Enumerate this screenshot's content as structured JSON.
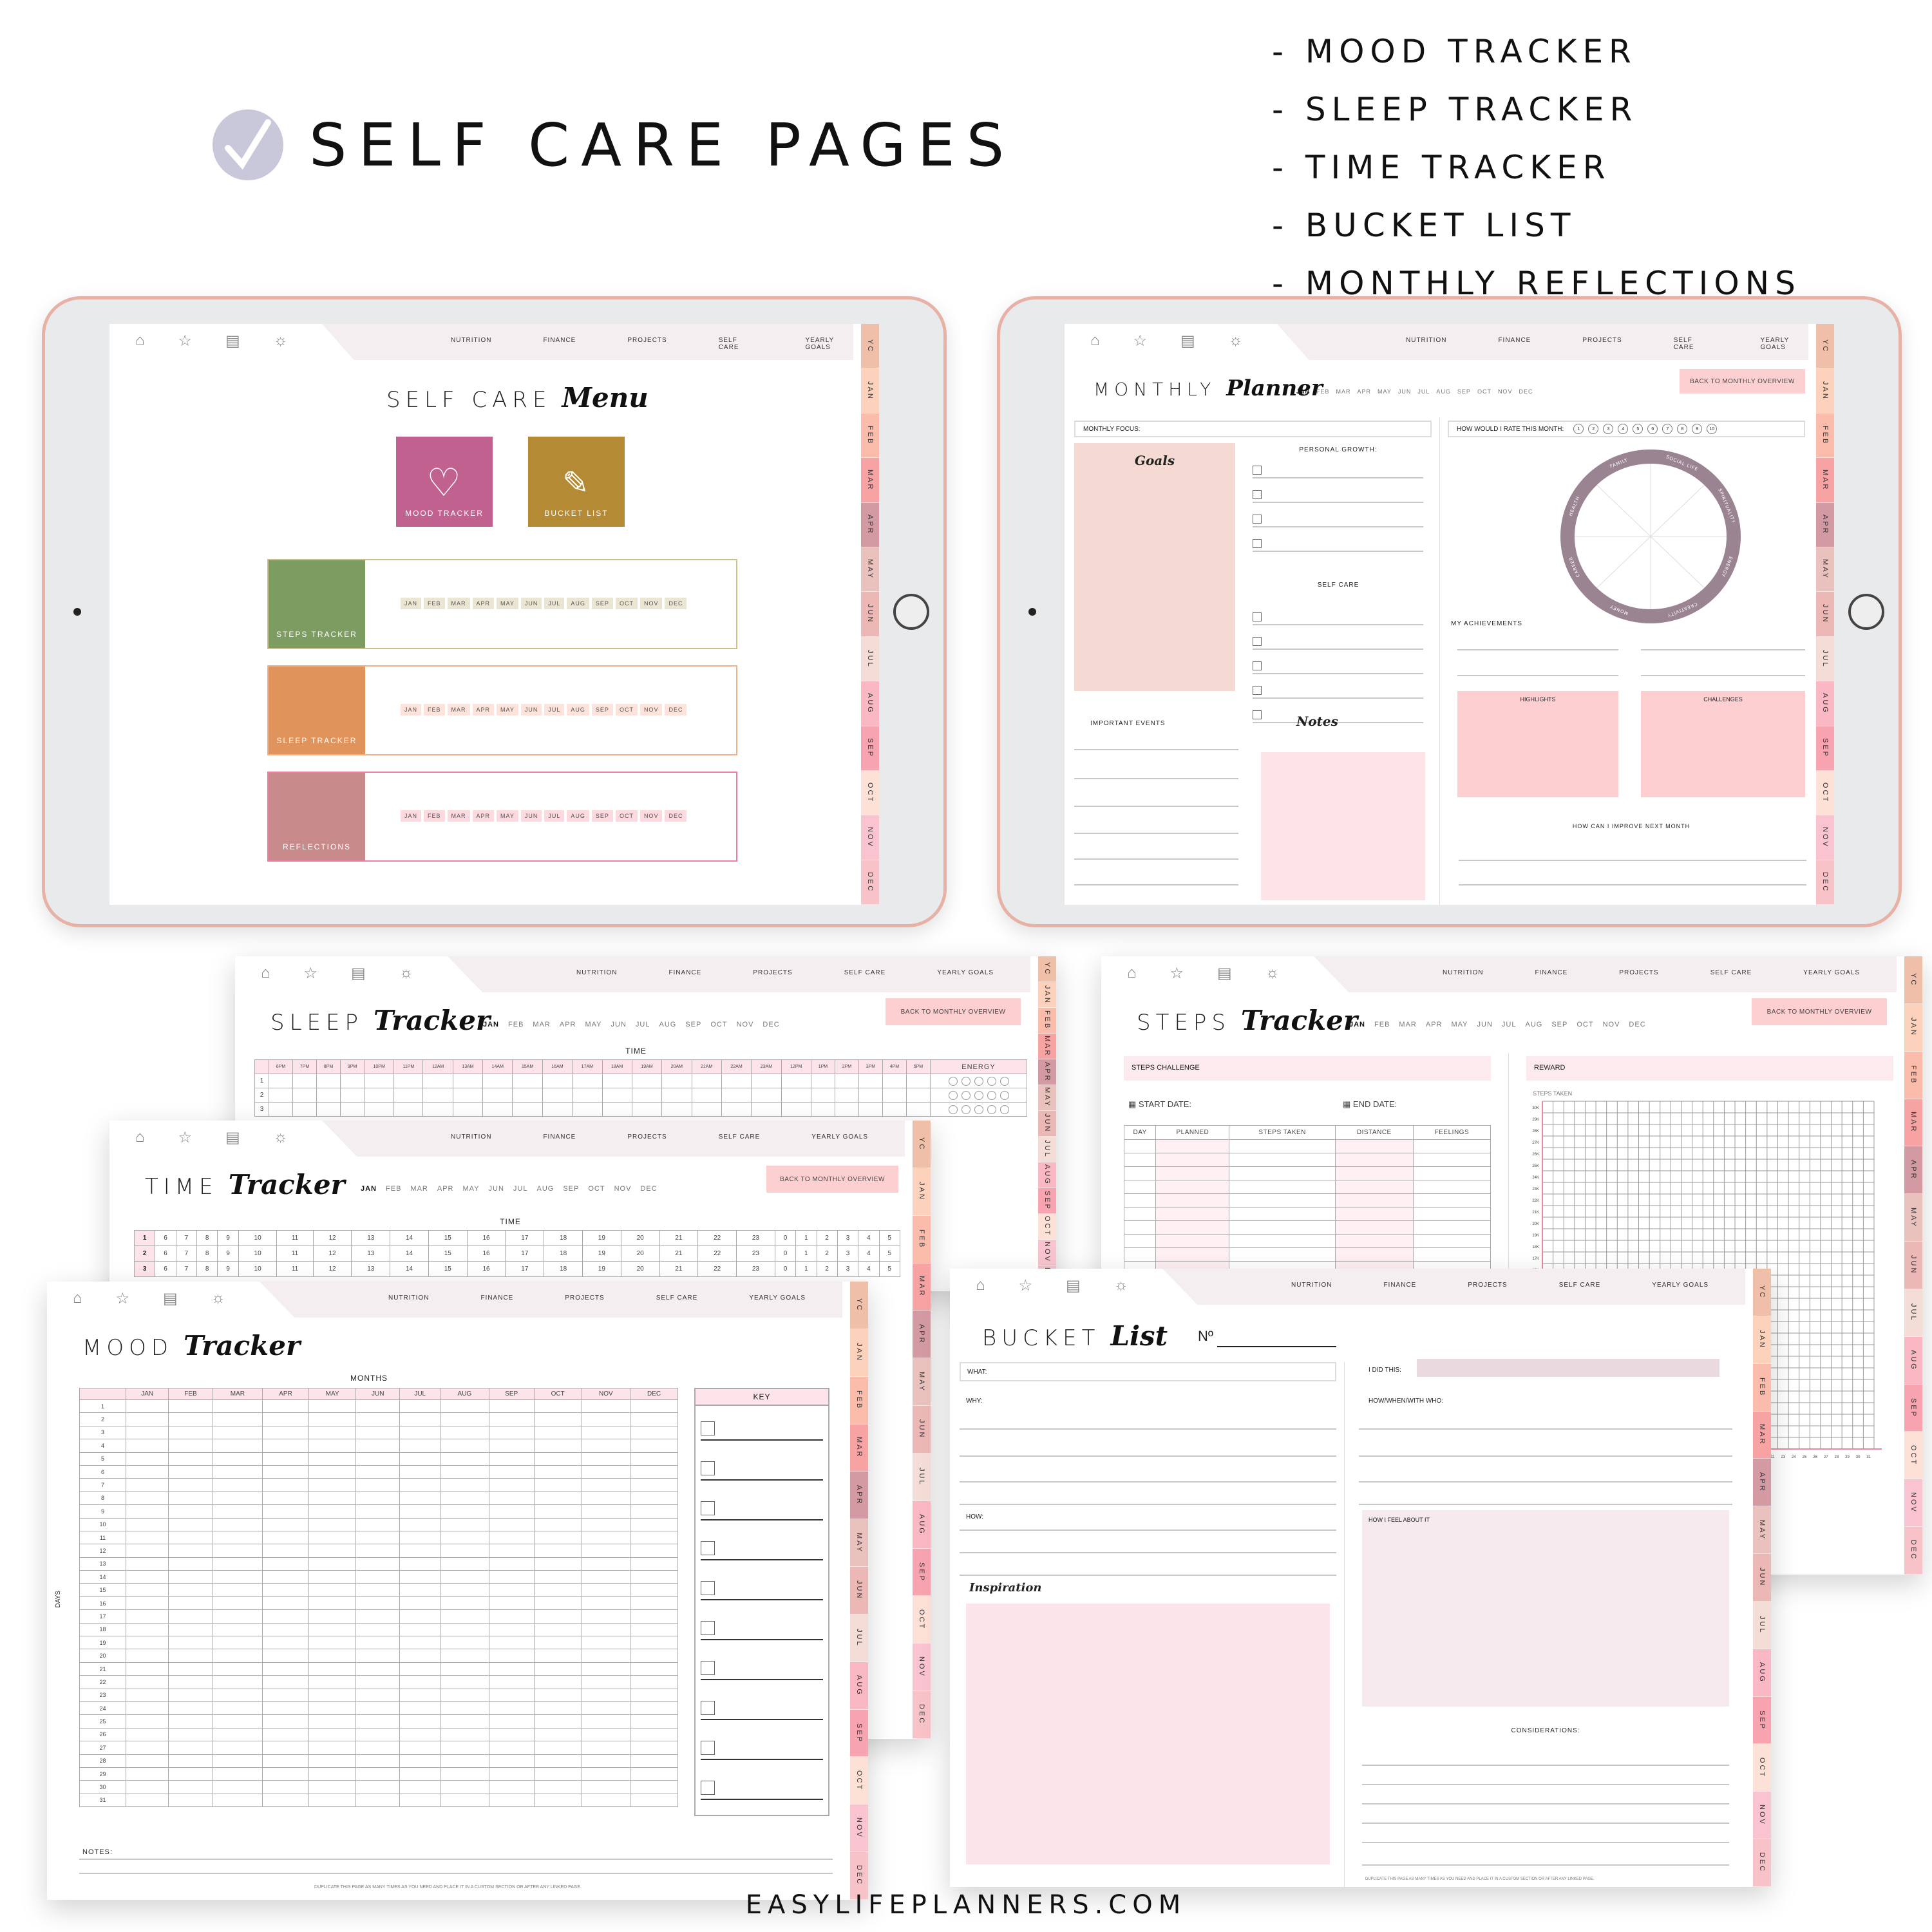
{
  "header": {
    "title": "SELF CARE PAGES",
    "check_icon": "check-circle-icon",
    "features": [
      "- MOOD TRACKER",
      "- SLEEP TRACKER",
      "- TIME TRACKER",
      "- BUCKET LIST",
      "- MONTHLY REFLECTIONS"
    ]
  },
  "footer": {
    "url": "EASYLIFEPLANNERS.COM"
  },
  "nav": {
    "icons": [
      "home-icon",
      "star-icon",
      "notebook-icon",
      "lightbulb-icon"
    ],
    "links": [
      "NUTRITION",
      "FINANCE",
      "PROJECTS",
      "SELF CARE",
      "YEARLY GOALS"
    ]
  },
  "side_tabs": [
    {
      "label": "YC",
      "color": "#f0bfa9"
    },
    {
      "label": "JAN",
      "color": "#fcd2bc"
    },
    {
      "label": "FEB",
      "color": "#fbbcac"
    },
    {
      "label": "MAR",
      "color": "#f7a3a3"
    },
    {
      "label": "APR",
      "color": "#d39aa3"
    },
    {
      "label": "MAY",
      "color": "#e9c1bd"
    },
    {
      "label": "JUN",
      "color": "#ecb8b6"
    },
    {
      "label": "JUL",
      "color": "#f3ddd6"
    },
    {
      "label": "AUG",
      "color": "#f9b8c3"
    },
    {
      "label": "SEP",
      "color": "#f7a4b0"
    },
    {
      "label": "OCT",
      "color": "#fde0d6"
    },
    {
      "label": "NOV",
      "color": "#f9c4cf"
    },
    {
      "label": "DEC",
      "color": "#f7c3c9"
    }
  ],
  "months": [
    "JAN",
    "FEB",
    "MAR",
    "APR",
    "MAY",
    "JUN",
    "JUL",
    "AUG",
    "SEP",
    "OCT",
    "NOV",
    "DEC"
  ],
  "back_button": "BACK TO MONTHLY OVERVIEW",
  "self_care_menu": {
    "title_plain": "SELF CARE",
    "title_script": "Menu",
    "tiles": [
      {
        "label": "MOOD TRACKER",
        "color": "#c0618f",
        "icon": "heart-icon"
      },
      {
        "label": "BUCKET LIST",
        "color": "#b48a35",
        "icon": "notebook-pen-icon"
      }
    ],
    "rows": [
      {
        "label": "STEPS TRACKER",
        "color": "#7d9c62",
        "border": "#c9c08a",
        "chip": "#ebe6d3",
        "icon": "sneaker-icon"
      },
      {
        "label": "SLEEP TRACKER",
        "color": "#e0935a",
        "border": "#f0b28c",
        "chip": "#fde3d9",
        "icon": "sleep-mask-icon"
      },
      {
        "label": "REFLECTIONS",
        "color": "#c98a8c",
        "border": "#ef7fa0",
        "chip": "#fdd9e0",
        "icon": "meditation-icon"
      }
    ]
  },
  "monthly_planner": {
    "title_plain": "MONTHLY",
    "title_script": "Planner",
    "monthly_focus": "MONTHLY FOCUS:",
    "goals": "Goals",
    "personal_growth": "PERSONAL GROWTH:",
    "self_care": "SELF CARE",
    "rate_label": "HOW WOULD I RATE THIS MONTH:",
    "rating_options": [
      "1",
      "2",
      "3",
      "4",
      "5",
      "6",
      "7",
      "8",
      "9",
      "10"
    ],
    "wheel_labels": [
      "FAMILY",
      "SOCIAL LIFE",
      "SPIRITUALITY",
      "ENERGY",
      "CREATIVITY",
      "MONEY",
      "CAREER",
      "HEALTH"
    ],
    "achievements": "MY ACHIEVEMENTS",
    "important_events": "IMPORTANT EVENTS",
    "notes": "Notes",
    "highlights": "HIGHLIGHTS",
    "challenges": "CHALLENGES",
    "improve": "HOW CAN I IMPROVE NEXT MONTH"
  },
  "sleep_tracker": {
    "title_plain": "SLEEP",
    "title_script": "Tracker",
    "time_label": "TIME",
    "hours": [
      "6PM",
      "7PM",
      "8PM",
      "9PM",
      "10PM",
      "11PM",
      "12AM",
      "13AM",
      "14AM",
      "15AM",
      "16AM",
      "17AM",
      "18AM",
      "19AM",
      "20AM",
      "21AM",
      "22AM",
      "23AM",
      "12PM",
      "1PM",
      "2PM",
      "3PM",
      "4PM",
      "5PM"
    ],
    "energy_label": "ENERGY",
    "rows": [
      "1",
      "2",
      "3"
    ]
  },
  "steps_tracker": {
    "title_plain": "STEPS",
    "title_script": "Tracker",
    "challenge": "STEPS CHALLENGE",
    "reward": "REWARD",
    "start_date": "START DATE:",
    "end_date": "END DATE:",
    "columns": [
      "DAY",
      "PLANNED",
      "STEPS TAKEN",
      "DISTANCE",
      "FEELINGS"
    ],
    "chart_label": "STEPS TAKEN",
    "y_ticks": [
      "30K",
      "29K",
      "28K",
      "27K",
      "26K",
      "25K",
      "24K",
      "23K",
      "22K",
      "21K",
      "20K",
      "19K",
      "18K",
      "17K",
      "16K"
    ],
    "x_ticks_visible": [
      "22",
      "23",
      "24",
      "25",
      "26",
      "27",
      "28",
      "29",
      "30",
      "31"
    ]
  },
  "time_tracker": {
    "title_plain": "TIME",
    "title_script": "Tracker",
    "time_label": "TIME",
    "hours": [
      "6",
      "7",
      "8",
      "9",
      "10",
      "11",
      "12",
      "13",
      "14",
      "15",
      "16",
      "17",
      "18",
      "19",
      "20",
      "21",
      "22",
      "23",
      "0",
      "1",
      "2",
      "3",
      "4",
      "5"
    ],
    "rows": [
      "1",
      "2",
      "3"
    ]
  },
  "mood_tracker": {
    "title_plain": "MOOD",
    "title_script": "Tracker",
    "months_label": "MONTHS",
    "days_label": "DAYS",
    "key_label": "KEY",
    "notes_label": "NOTES:",
    "footnote": "DUPLICATE THIS PAGE AS MANY TIMES AS YOU NEED AND PLACE IT IN A CUSTOM SECTION OR AFTER ANY LINKED PAGE."
  },
  "bucket_list": {
    "title_plain": "BUCKET",
    "title_script": "List",
    "number_label": "Nº",
    "what": "WHAT:",
    "why": "WHY:",
    "how": "HOW:",
    "i_did_this": "I DID THIS:",
    "how_when_who": "HOW/WHEN/WITH WHO:",
    "feel": "HOW I FEEL ABOUT IT",
    "inspiration": "Inspiration",
    "considerations": "CONSIDERATIONS:",
    "footnote": "DUPLICATE THIS PAGE AS MANY TIMES AS YOU NEED AND PLACE IT IN A CUSTOM SECTION OR AFTER ANY LINKED PAGE."
  }
}
